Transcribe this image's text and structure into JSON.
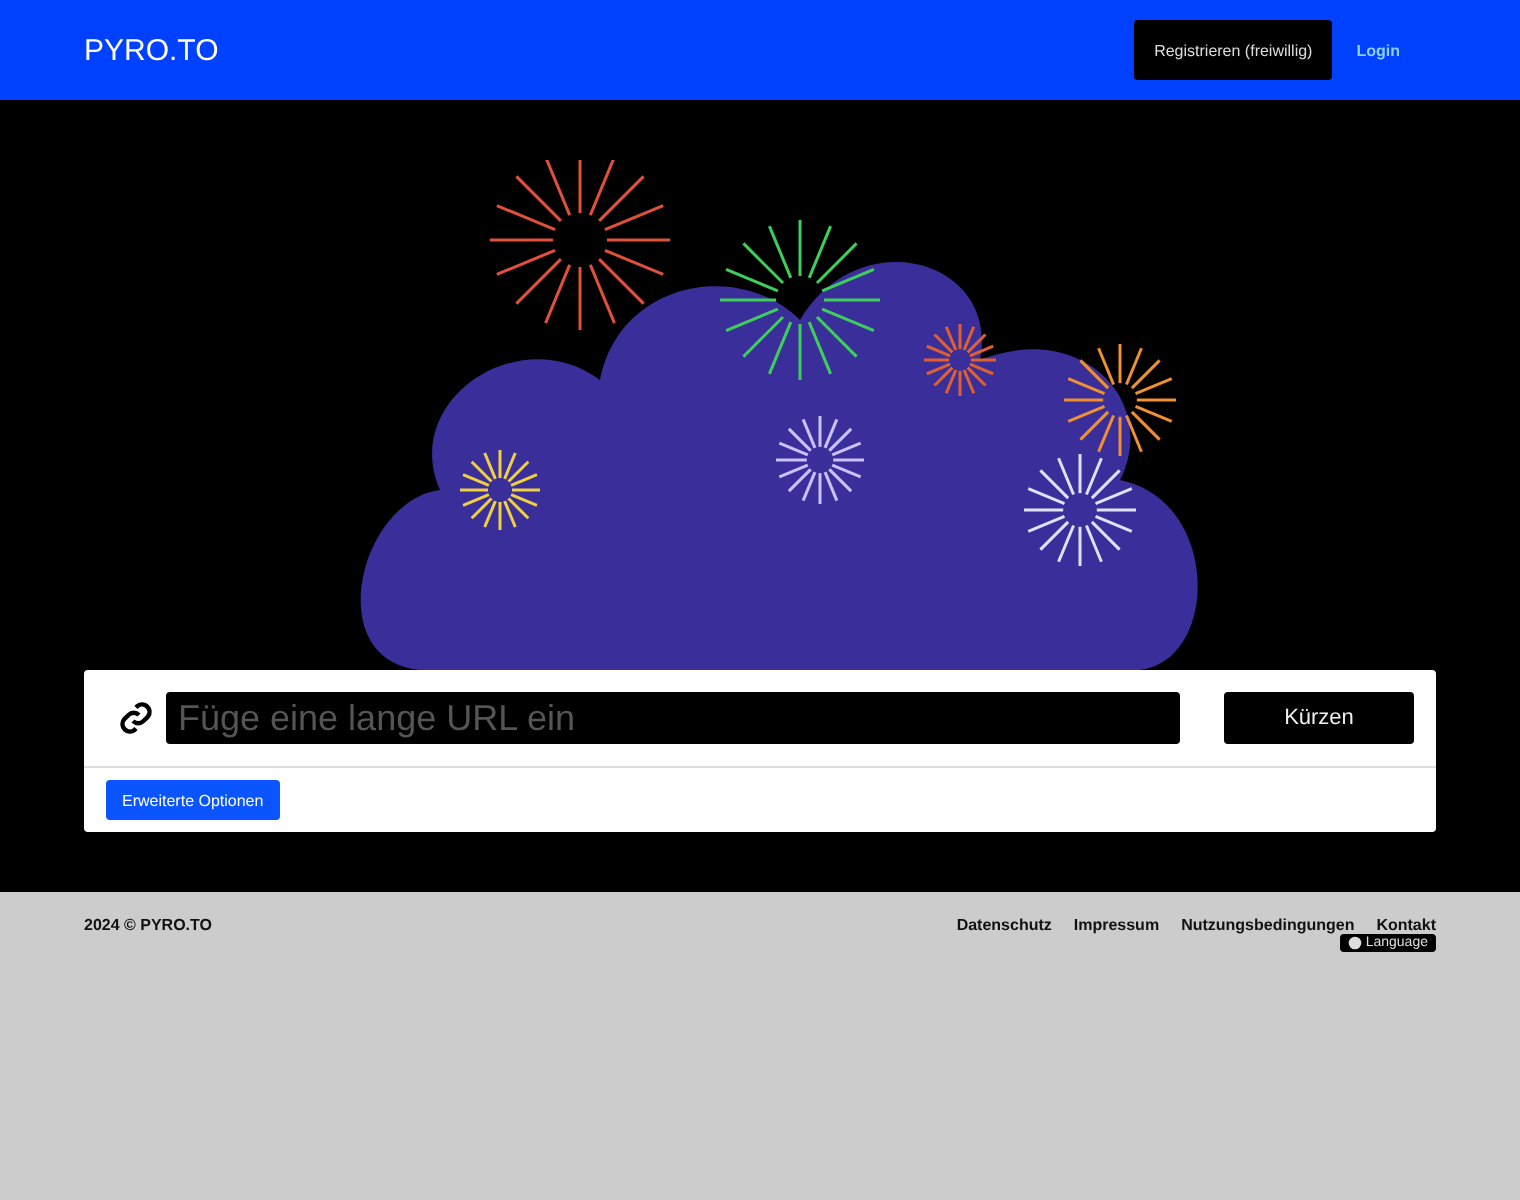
{
  "header": {
    "logo": "PYRO.TO",
    "register_button": "Registrieren (freiwillig)",
    "login_link": "Login"
  },
  "shortener": {
    "url_placeholder": "Füge eine lange URL ein",
    "submit_button": "Kürzen",
    "options_button": "Erweiterte Optionen"
  },
  "footer": {
    "copyright": "2024 © PYRO.TO",
    "links": [
      "Datenschutz",
      "Impressum",
      "Nutzungsbedingungen",
      "Kontakt"
    ],
    "language_button": "Language"
  }
}
